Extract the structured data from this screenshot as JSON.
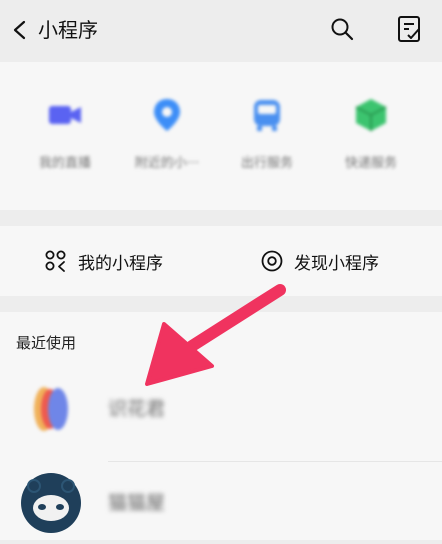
{
  "header": {
    "title": "小程序",
    "back_icon": "chevron-left-icon",
    "search_icon": "search-icon",
    "edit_icon": "notepad-edit-icon"
  },
  "favorites": [
    {
      "label": "我的直播",
      "icon": "video-camera-icon",
      "color": "#5a63f2"
    },
    {
      "label": "附近的小···",
      "icon": "location-pin-icon",
      "color": "#3d8ef7"
    },
    {
      "label": "出行服务",
      "icon": "bus-icon",
      "color": "#4a90f0"
    },
    {
      "label": "快递服务",
      "icon": "package-icon",
      "color": "#3cc46f"
    }
  ],
  "entries": {
    "my_programs": "我的小程序",
    "discover": "发现小程序"
  },
  "recent": {
    "title": "最近使用",
    "items": [
      {
        "name": "识花君"
      },
      {
        "name": "猫猫屋"
      }
    ]
  },
  "colors": {
    "arrow": "#f0335f",
    "background": "#ededed",
    "panel": "#f7f7f7"
  }
}
